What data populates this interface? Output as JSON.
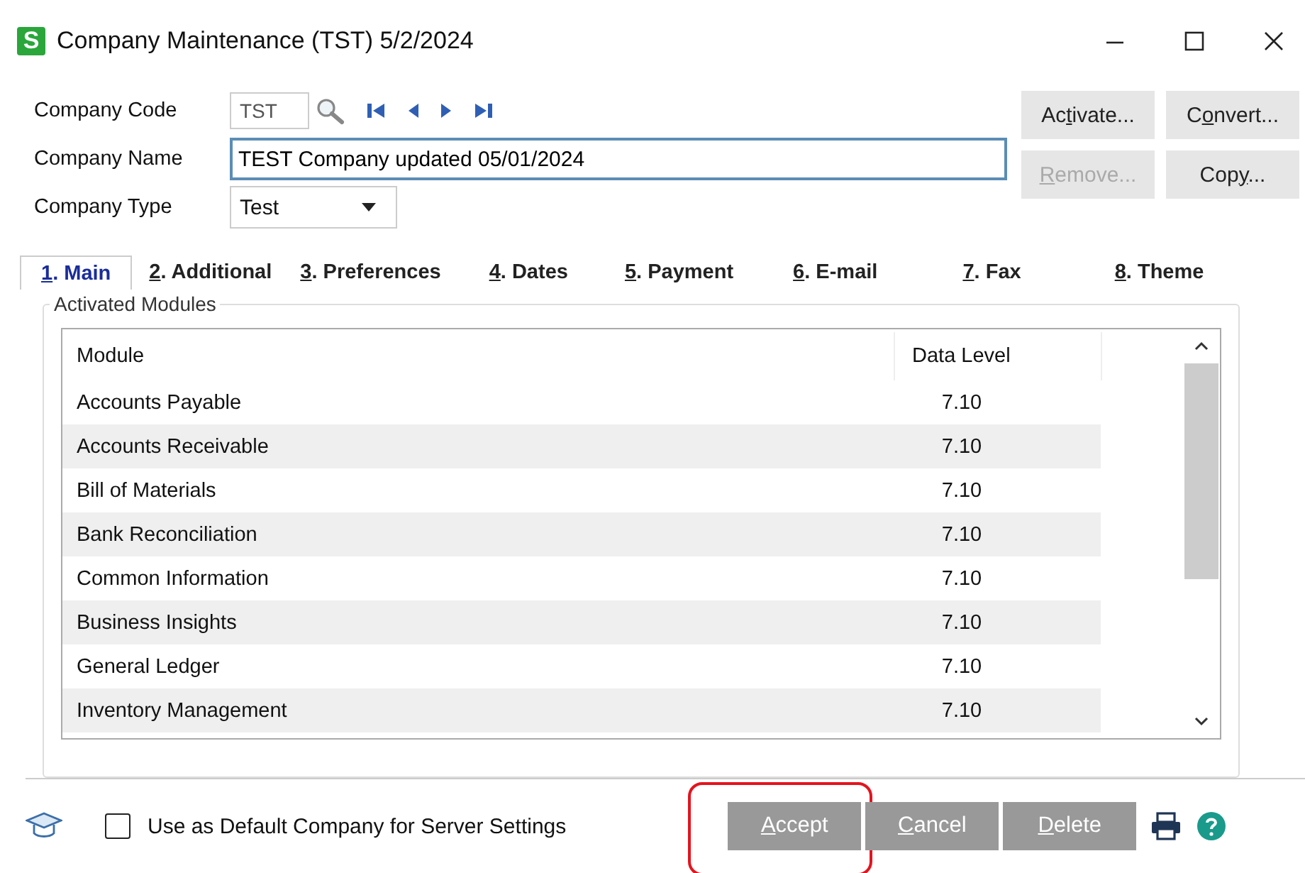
{
  "window": {
    "title": "Company Maintenance (TST) 5/2/2024",
    "app_badge": "S"
  },
  "form": {
    "fields": [
      {
        "label": "Company Code",
        "kind": "code",
        "value": "TST"
      },
      {
        "label": "Company Name",
        "kind": "text",
        "value": "TEST Company updated 05/01/2024",
        "focused": true
      },
      {
        "label": "Company Type",
        "kind": "select",
        "value": "Test"
      }
    ]
  },
  "side_buttons": [
    {
      "pre": "Ac",
      "key": "t",
      "post": "ivate...",
      "disabled": false
    },
    {
      "pre": "C",
      "key": "o",
      "post": "nvert...",
      "disabled": false
    },
    {
      "key": "R",
      "post": "emove...",
      "disabled": true
    },
    {
      "pre": "Cop",
      "key": "y",
      "post": "...",
      "disabled": false
    }
  ],
  "tabs": [
    {
      "key": "1",
      "post": ". Main",
      "selected": true
    },
    {
      "key": "2",
      "post": ". Additional",
      "selected": false
    },
    {
      "key": "3",
      "post": ". Preferences",
      "selected": false
    },
    {
      "key": "4",
      "post": ". Dates",
      "selected": false
    },
    {
      "key": "5",
      "post": ". Payment",
      "selected": false
    },
    {
      "key": "6",
      "post": ". E-mail",
      "selected": false
    },
    {
      "key": "7",
      "post": ". Fax",
      "selected": false
    },
    {
      "key": "8",
      "post": ". Theme",
      "selected": false
    }
  ],
  "group": {
    "title": "Activated Modules"
  },
  "table": {
    "columns": [
      "Module",
      "Data Level"
    ],
    "rows": [
      [
        "Accounts Payable",
        "7.10"
      ],
      [
        "Accounts Receivable",
        "7.10"
      ],
      [
        "Bill of Materials",
        "7.10"
      ],
      [
        "Bank Reconciliation",
        "7.10"
      ],
      [
        "Common Information",
        "7.10"
      ],
      [
        "Business Insights",
        "7.10"
      ],
      [
        "General Ledger",
        "7.10"
      ],
      [
        "Inventory Management",
        "7.10"
      ]
    ]
  },
  "footer": {
    "checkbox": {
      "label": "Use as Default Company for Server Settings",
      "checked": false
    },
    "buttons": [
      {
        "key": "A",
        "post": "ccept",
        "highlighted": true
      },
      {
        "key": "C",
        "post": "ancel",
        "highlighted": false
      },
      {
        "key": "D",
        "post": "elete",
        "highlighted": false
      }
    ]
  }
}
